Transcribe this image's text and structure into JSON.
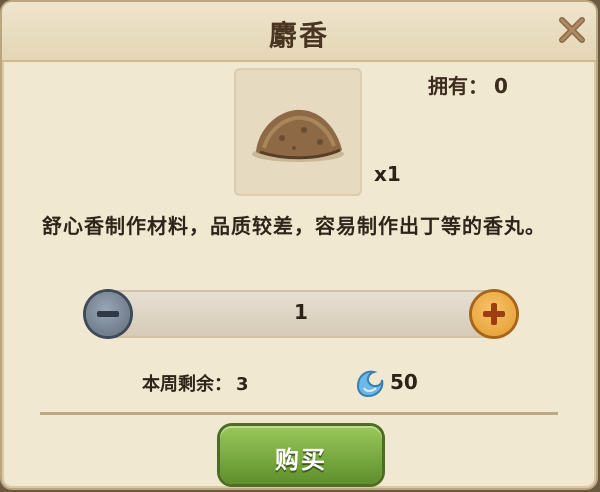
{
  "dialog": {
    "title": "麝香",
    "owned_label": "拥有：",
    "owned_value": "0",
    "item": {
      "quantity_label": "x1",
      "icon": "musk-lump-icon"
    },
    "description": "舒心香制作材料，品质较差，容易制作出丁等的香丸。",
    "stepper": {
      "value": "1",
      "minus_icon": "minus-icon",
      "plus_icon": "plus-icon"
    },
    "weekly_remaining_label": "本周剩余：",
    "weekly_remaining_value": "3",
    "price": {
      "icon": "blue-currency-icon",
      "value": "50"
    },
    "buy_label": "购买"
  },
  "colors": {
    "panel": "#f1e8d2",
    "buy_button": "#7aaa3f",
    "plus_button": "#f0ad45",
    "minus_button": "#7d8898"
  }
}
